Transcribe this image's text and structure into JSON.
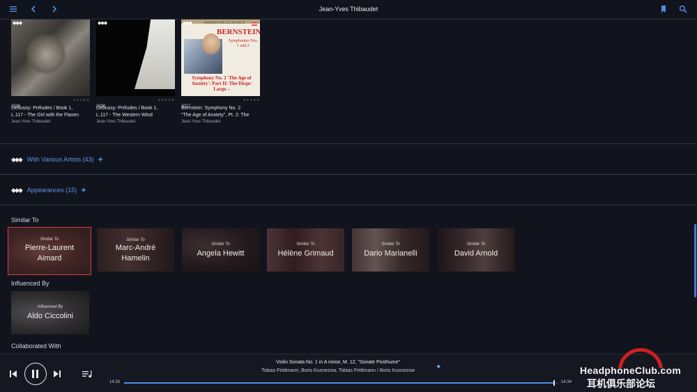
{
  "header": {
    "title": "Jean-Yves Thibaudet"
  },
  "albums": [
    {
      "year": "2006",
      "title_line1": "Debussy: Préludes / Book 1,",
      "title_line2": "L.117 - The Girl with the Flaxen",
      "artist": "Jean-Yves Thibaudet",
      "rating": "★★★★★"
    },
    {
      "year": "2006",
      "title_line1": "Debussy: Préludes / Book 1,",
      "title_line2": "L.117 - The Western Wind",
      "artist": "Jean-Yves Thibaudet",
      "rating": "★★★★★"
    },
    {
      "year": "2017",
      "title_line1": "Bernstein: Symphony No. 2",
      "title_line2": "\"The Age of Anxiety\", Pt. 2: The",
      "artist": "Jean-Yves Thibaudet",
      "rating": "★★★★★",
      "cover_text": {
        "series": "AMERICAN CLASSICS",
        "composer": "BERNSTEIN",
        "subtitle": "Symphonies Nos. 1 and 2",
        "work": "Symphony No. 2 'The Age of Anxiety': Part II: The Dirge: Largo –"
      }
    }
  ],
  "sections": {
    "various": {
      "label": "With Various Artists (43)",
      "plus": "+"
    },
    "appearances": {
      "label": "Appearances (15)",
      "plus": "+"
    },
    "similar_title": "Similar To",
    "influenced_title": "Influenced By",
    "collaborated_title": "Collaborated With"
  },
  "similar": [
    {
      "sub": "Similar To",
      "line1": "Pierre-Laurent",
      "line2": "Aimard",
      "selected": true
    },
    {
      "sub": "Similar To",
      "line1": "Marc-André",
      "line2": "Hamelin"
    },
    {
      "sub": "Similar To",
      "line1": "Angela Hewitt",
      "line2": ""
    },
    {
      "sub": "Similar To",
      "line1": "Hélène Grimaud",
      "line2": ""
    },
    {
      "sub": "Similar To",
      "line1": "Dario Marianelli",
      "line2": ""
    },
    {
      "sub": "Similar To",
      "line1": "David Arnold",
      "line2": ""
    }
  ],
  "influenced": [
    {
      "sub": "Influenced By",
      "line1": "Aldo Ciccolini"
    }
  ],
  "player": {
    "track_title": "Violin Sonata No. 1 in A minor, M. 12, \"Sonate Posthume\"",
    "track_artists": "Tobias Feldmann, Boris Kusnezow, Tobias Feldmann / Boris Kusnezow",
    "elapsed": "14:33",
    "total": "14:34",
    "progress": 0.99
  },
  "watermark": {
    "line1": "HeadphoneClub.com",
    "line2": "耳机俱乐部论坛"
  },
  "colors": {
    "accent": "#4f8fe8",
    "selection": "#d9413a",
    "background": "#12141d"
  }
}
